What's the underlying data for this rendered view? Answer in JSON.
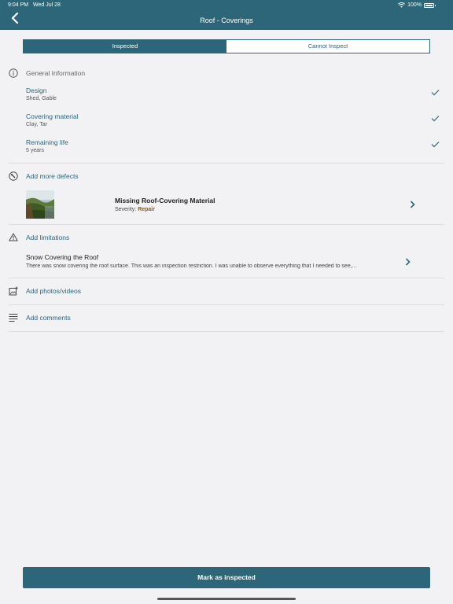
{
  "status_bar": {
    "time": "9:04 PM",
    "date": "Wed Jul 28",
    "battery": "100%"
  },
  "nav": {
    "title": "Roof - Coverings"
  },
  "segments": [
    {
      "label": "Inspected",
      "selected": true
    },
    {
      "label": "Cannot Inspect",
      "selected": false
    }
  ],
  "general": {
    "header": "General Information",
    "rows": [
      {
        "label": "Design",
        "value": "Shed, Gable"
      },
      {
        "label": "Covering material",
        "value": "Clay, Tar"
      },
      {
        "label": "Remaining life",
        "value": "5  years"
      }
    ]
  },
  "defects": {
    "header": "Add more defects",
    "items": [
      {
        "title": "Missing Roof-Covering Material",
        "severity_label": "Severity:",
        "severity": "Repair"
      }
    ]
  },
  "limitations": {
    "header": "Add limitations",
    "items": [
      {
        "title": "Snow Covering the Roof",
        "text": "There was snow covering the roof surface.  This was an inspection restriction.  I was unable to observe everything that I needed to see,..."
      }
    ]
  },
  "photos": {
    "label": "Add photos/videos"
  },
  "comments": {
    "label": "Add comments"
  },
  "footer": {
    "button_label": "Mark as inspected"
  },
  "colors": {
    "accent": "#2d6678",
    "background": "#f2f2f4",
    "severity_repair": "#8a5a12"
  }
}
